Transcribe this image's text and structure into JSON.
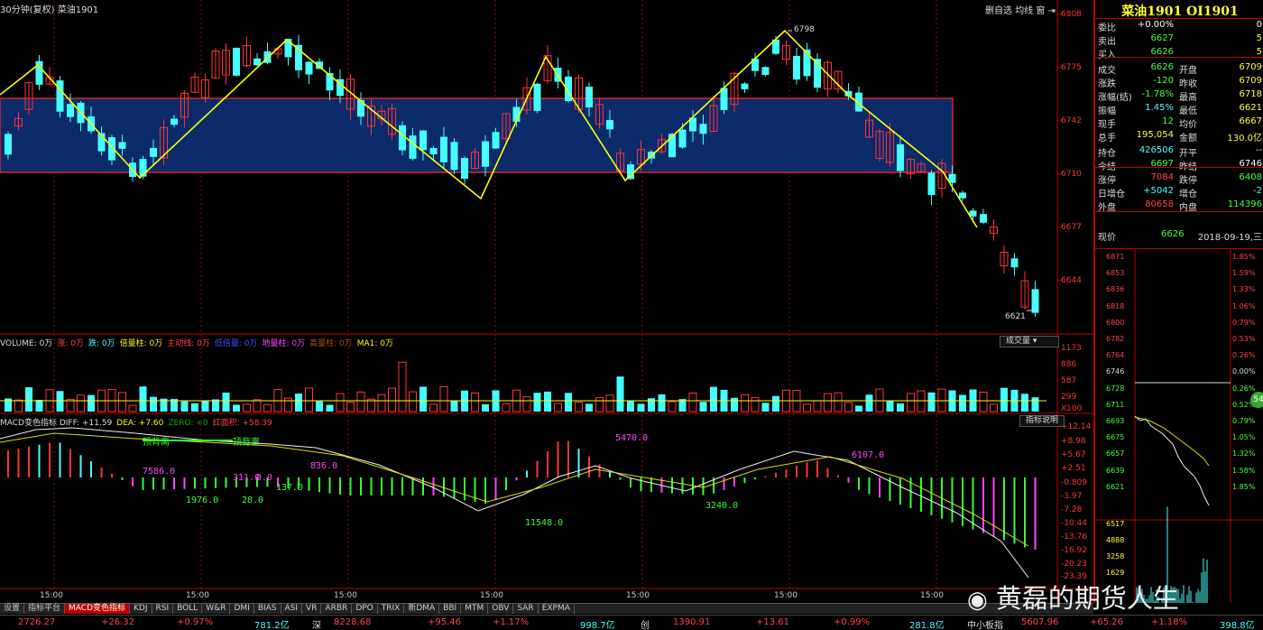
{
  "window": {
    "title_left": "30分钟(复权)  菜油1901",
    "controls": [
      "删自选",
      "均线",
      "窗"
    ],
    "close_icon": "close-icon"
  },
  "price_axis": {
    "ticks": [
      "6808",
      "6775",
      "6742",
      "6710",
      "6677",
      "6644"
    ],
    "high_label": "6798",
    "low_label": "6621"
  },
  "volume": {
    "legend": [
      {
        "text": "VOLUME: 0万",
        "color": "#dddddd"
      },
      {
        "text": "涨: 0万",
        "color": "#ff4444"
      },
      {
        "text": "跌: 0万",
        "color": "#44ffff"
      },
      {
        "text": "倍量柱: 0万",
        "color": "#ffff00"
      },
      {
        "text": "主动线: 0万",
        "color": "#ff4444"
      },
      {
        "text": "低倍量: 0万",
        "color": "#3355ff"
      },
      {
        "text": "地量柱: 0万",
        "color": "#ff44ff"
      },
      {
        "text": "高量柱: 0万",
        "color": "#aa5500"
      },
      {
        "text": "MA1: 0万",
        "color": "#ffff00"
      }
    ],
    "selector": "成交量",
    "ticks": [
      "1173",
      "886",
      "587",
      "299",
      "X100"
    ]
  },
  "macd": {
    "legend": [
      {
        "text": "MACD变色指标 DIFF: +11.59",
        "color": "#dddddd"
      },
      {
        "text": "DEA: +7.60",
        "color": "#ffff00"
      },
      {
        "text": "ZERO: +0",
        "color": "#00aa00"
      },
      {
        "text": "红面积: +58.39",
        "color": "#ff4444"
      }
    ],
    "button": "指标说明",
    "ticks": [
      "+12.14",
      "+8.98",
      "+5.67",
      "+2.51",
      "-0.809",
      "-3.97",
      "-7.28",
      "-10.44",
      "-13.76",
      "-16.92",
      "-20.23",
      "-23.39"
    ],
    "annotations": [
      {
        "text": "顶背离",
        "color": "#33ff33"
      },
      {
        "text": "顶背离",
        "color": "#33ff33"
      },
      {
        "text": "7586.0",
        "color": "#ff44ff"
      },
      {
        "text": "311.0",
        "color": "#ff44ff"
      },
      {
        "text": "836.0",
        "color": "#ff44ff"
      },
      {
        "text": "5470.0",
        "color": "#ff44ff"
      },
      {
        "text": "6107.0",
        "color": "#ff44ff"
      },
      {
        "text": "1976.0",
        "color": "#33ff33"
      },
      {
        "text": "28.0",
        "color": "#33ff33"
      },
      {
        "text": "137.0",
        "color": "#33ff33"
      },
      {
        "text": "11548.0",
        "color": "#33ff33"
      },
      {
        "text": "3240.0",
        "color": "#33ff33"
      },
      {
        "text": "0.0",
        "color": "#ff44ff"
      }
    ]
  },
  "time_axis": [
    "15:00",
    "15:00",
    "15:00",
    "15:00",
    "15:00",
    "15:00",
    "15:00"
  ],
  "tabs": [
    "设置",
    "指标平台",
    "MACD变色指标",
    "KDJ",
    "RSI",
    "BOLL",
    "W&R",
    "DMI",
    "BIAS",
    "ASI",
    "VR",
    "ARBR",
    "DPO",
    "TRIX",
    "新DMA",
    "BBI",
    "MTM",
    "OBV",
    "SAR",
    "EXPMA"
  ],
  "active_tab": "MACD变色指标",
  "status_bar": [
    {
      "text": "2726.27",
      "color": "#ff4444"
    },
    {
      "text": "+26.32",
      "color": "#ff4444"
    },
    {
      "text": "+0.97%",
      "color": "#ff4444"
    },
    {
      "text": "781.2亿",
      "color": "#44ffff"
    },
    {
      "text": "深",
      "color": "#dddddd"
    },
    {
      "text": "8228.68",
      "color": "#ff4444"
    },
    {
      "text": "+95.46",
      "color": "#ff4444"
    },
    {
      "text": "+1.17%",
      "color": "#ff4444"
    },
    {
      "text": "998.7亿",
      "color": "#44ffff"
    },
    {
      "text": "创",
      "color": "#dddddd"
    },
    {
      "text": "1390.91",
      "color": "#ff4444"
    },
    {
      "text": "+13.61",
      "color": "#ff4444"
    },
    {
      "text": "+0.99%",
      "color": "#ff4444"
    },
    {
      "text": "281.8亿",
      "color": "#44ffff"
    },
    {
      "text": "中小板指",
      "color": "#dddddd"
    },
    {
      "text": "5607.96",
      "color": "#ff4444"
    },
    {
      "text": "+65.26",
      "color": "#ff4444"
    },
    {
      "text": "+1.18%",
      "color": "#ff4444"
    },
    {
      "text": "398.8亿",
      "color": "#44ffff"
    }
  ],
  "quote": {
    "title": "菜油1901 OI1901",
    "rows": [
      {
        "l": "委比",
        "v": "+0.00%",
        "vc": "#ffffff",
        "l2": "",
        "v2": "0",
        "v2c": "#ffffff"
      },
      {
        "l": "卖出",
        "v": "6627",
        "vc": "#44ff44",
        "l2": "",
        "v2": "5",
        "v2c": "#ffff44"
      },
      {
        "l": "买入",
        "v": "6626",
        "vc": "#44ff44",
        "l2": "",
        "v2": "5",
        "v2c": "#ffff44"
      },
      {
        "l": "成交",
        "v": "6626",
        "vc": "#44ff44",
        "l2": "开盘",
        "v2": "6709",
        "v2c": "#ffff44"
      },
      {
        "l": "涨跌",
        "v": "-120",
        "vc": "#44ff44",
        "l2": "昨收",
        "v2": "6709",
        "v2c": "#ffff44"
      },
      {
        "l": "涨幅(结)",
        "v": "-1.78%",
        "vc": "#44ff44",
        "l2": "最高",
        "v2": "6718",
        "v2c": "#ffff44"
      },
      {
        "l": "振幅",
        "v": "1.45%",
        "vc": "#44ffff",
        "l2": "最低",
        "v2": "6621",
        "v2c": "#ffff44"
      },
      {
        "l": "现手",
        "v": "12",
        "vc": "#44ff44",
        "l2": "均价",
        "v2": "6667",
        "v2c": "#ffff44"
      },
      {
        "l": "总手",
        "v": "195,054",
        "vc": "#ffff44",
        "l2": "金额",
        "v2": "130.0亿",
        "v2c": "#ffff44"
      },
      {
        "l": "持仓",
        "v": "426506",
        "vc": "#44ffff",
        "l2": "开平",
        "v2": "--",
        "v2c": "#dddddd"
      },
      {
        "l": "今结",
        "v": "6697",
        "vc": "#44ff44",
        "l2": "昨结",
        "v2": "6746",
        "v2c": "#ffffff"
      },
      {
        "l": "涨停",
        "v": "7084",
        "vc": "#ff4444",
        "l2": "跌停",
        "v2": "6408",
        "v2c": "#44ff44"
      },
      {
        "l": "日增仓",
        "v": "+5042",
        "vc": "#44ffff",
        "l2": "增仓",
        "v2": "-2",
        "v2c": "#44ffff"
      },
      {
        "l": "外盘",
        "v": "80658",
        "vc": "#ff4444",
        "l2": "内盘",
        "v2": "114396",
        "v2c": "#44ff44"
      }
    ],
    "now_label": "现价",
    "now_value": "6626",
    "date": "2018-09-19,三"
  },
  "mini_chart": {
    "left_ticks": [
      "6871",
      "6853",
      "6836",
      "6818",
      "6800",
      "6782",
      "6764",
      "6746",
      "6728",
      "6711",
      "6693",
      "6675",
      "6657",
      "6639",
      "6621",
      "6517",
      "4888",
      "3258",
      "1629"
    ],
    "right_ticks": [
      "1.85%",
      "1.59%",
      "1.33%",
      "1.06%",
      "0.79%",
      "0.53%",
      "0.26%",
      "0.00%",
      "0.26%",
      "0.52%",
      "0.79%",
      "1.05%",
      "1.32%",
      "1.58%",
      "1.85%"
    ],
    "badge": "54"
  },
  "watermark": "黄磊的期货人生",
  "colors": {
    "up": "#ff3333",
    "down": "#44ffff",
    "accent": "#ffff00",
    "frame": "#bb0000"
  }
}
